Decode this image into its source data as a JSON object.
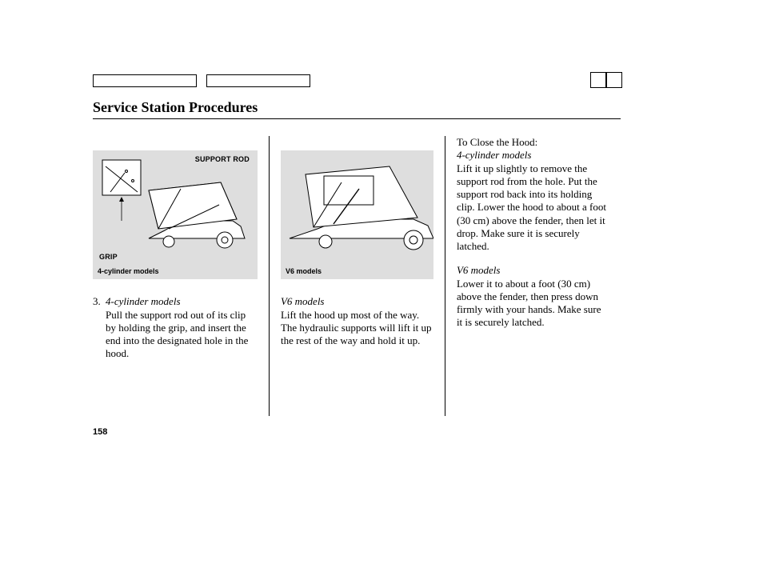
{
  "title": "Service Station Procedures",
  "page_number": "158",
  "col1": {
    "callout_support_rod": "SUPPORT ROD",
    "callout_grip": "GRIP",
    "fig_caption": "4-cylinder models",
    "item_num": "3.",
    "item_heading": "4-cylinder models",
    "item_body": "Pull the support rod out of its clip by holding the grip, and insert the end into the designated hole in the hood."
  },
  "col2": {
    "fig_caption": "V6 models",
    "item_heading": "V6 models",
    "item_body": "Lift the hood up most of the way. The hydraulic supports will lift it up the rest of the way and hold it up."
  },
  "col3": {
    "close_heading": "To Close the Hood:",
    "p4_heading": "4-cylinder models",
    "p4_body": "Lift it up slightly to remove the support rod from the hole. Put the support rod back into its holding clip. Lower the hood to about a foot (30 cm) above the fender, then let it drop. Make sure it is securely latched.",
    "v6_heading": "V6 models",
    "v6_body": "Lower it to about a foot (30 cm) above the fender, then press down firmly with your hands. Make sure it is securely latched."
  }
}
